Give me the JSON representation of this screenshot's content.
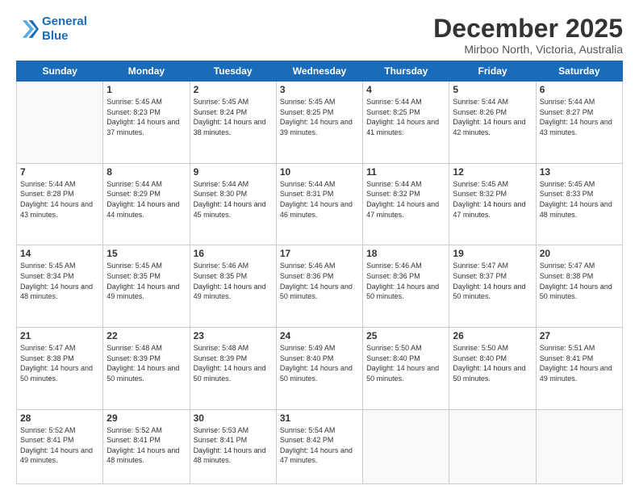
{
  "logo": {
    "line1": "General",
    "line2": "Blue"
  },
  "title": "December 2025",
  "subtitle": "Mirboo North, Victoria, Australia",
  "weekdays": [
    "Sunday",
    "Monday",
    "Tuesday",
    "Wednesday",
    "Thursday",
    "Friday",
    "Saturday"
  ],
  "weeks": [
    [
      {
        "day": "",
        "sunrise": "",
        "sunset": "",
        "daylight": ""
      },
      {
        "day": "1",
        "sunrise": "Sunrise: 5:45 AM",
        "sunset": "Sunset: 8:23 PM",
        "daylight": "Daylight: 14 hours and 37 minutes."
      },
      {
        "day": "2",
        "sunrise": "Sunrise: 5:45 AM",
        "sunset": "Sunset: 8:24 PM",
        "daylight": "Daylight: 14 hours and 38 minutes."
      },
      {
        "day": "3",
        "sunrise": "Sunrise: 5:45 AM",
        "sunset": "Sunset: 8:25 PM",
        "daylight": "Daylight: 14 hours and 39 minutes."
      },
      {
        "day": "4",
        "sunrise": "Sunrise: 5:44 AM",
        "sunset": "Sunset: 8:25 PM",
        "daylight": "Daylight: 14 hours and 41 minutes."
      },
      {
        "day": "5",
        "sunrise": "Sunrise: 5:44 AM",
        "sunset": "Sunset: 8:26 PM",
        "daylight": "Daylight: 14 hours and 42 minutes."
      },
      {
        "day": "6",
        "sunrise": "Sunrise: 5:44 AM",
        "sunset": "Sunset: 8:27 PM",
        "daylight": "Daylight: 14 hours and 43 minutes."
      }
    ],
    [
      {
        "day": "7",
        "sunrise": "Sunrise: 5:44 AM",
        "sunset": "Sunset: 8:28 PM",
        "daylight": "Daylight: 14 hours and 43 minutes."
      },
      {
        "day": "8",
        "sunrise": "Sunrise: 5:44 AM",
        "sunset": "Sunset: 8:29 PM",
        "daylight": "Daylight: 14 hours and 44 minutes."
      },
      {
        "day": "9",
        "sunrise": "Sunrise: 5:44 AM",
        "sunset": "Sunset: 8:30 PM",
        "daylight": "Daylight: 14 hours and 45 minutes."
      },
      {
        "day": "10",
        "sunrise": "Sunrise: 5:44 AM",
        "sunset": "Sunset: 8:31 PM",
        "daylight": "Daylight: 14 hours and 46 minutes."
      },
      {
        "day": "11",
        "sunrise": "Sunrise: 5:44 AM",
        "sunset": "Sunset: 8:32 PM",
        "daylight": "Daylight: 14 hours and 47 minutes."
      },
      {
        "day": "12",
        "sunrise": "Sunrise: 5:45 AM",
        "sunset": "Sunset: 8:32 PM",
        "daylight": "Daylight: 14 hours and 47 minutes."
      },
      {
        "day": "13",
        "sunrise": "Sunrise: 5:45 AM",
        "sunset": "Sunset: 8:33 PM",
        "daylight": "Daylight: 14 hours and 48 minutes."
      }
    ],
    [
      {
        "day": "14",
        "sunrise": "Sunrise: 5:45 AM",
        "sunset": "Sunset: 8:34 PM",
        "daylight": "Daylight: 14 hours and 48 minutes."
      },
      {
        "day": "15",
        "sunrise": "Sunrise: 5:45 AM",
        "sunset": "Sunset: 8:35 PM",
        "daylight": "Daylight: 14 hours and 49 minutes."
      },
      {
        "day": "16",
        "sunrise": "Sunrise: 5:46 AM",
        "sunset": "Sunset: 8:35 PM",
        "daylight": "Daylight: 14 hours and 49 minutes."
      },
      {
        "day": "17",
        "sunrise": "Sunrise: 5:46 AM",
        "sunset": "Sunset: 8:36 PM",
        "daylight": "Daylight: 14 hours and 50 minutes."
      },
      {
        "day": "18",
        "sunrise": "Sunrise: 5:46 AM",
        "sunset": "Sunset: 8:36 PM",
        "daylight": "Daylight: 14 hours and 50 minutes."
      },
      {
        "day": "19",
        "sunrise": "Sunrise: 5:47 AM",
        "sunset": "Sunset: 8:37 PM",
        "daylight": "Daylight: 14 hours and 50 minutes."
      },
      {
        "day": "20",
        "sunrise": "Sunrise: 5:47 AM",
        "sunset": "Sunset: 8:38 PM",
        "daylight": "Daylight: 14 hours and 50 minutes."
      }
    ],
    [
      {
        "day": "21",
        "sunrise": "Sunrise: 5:47 AM",
        "sunset": "Sunset: 8:38 PM",
        "daylight": "Daylight: 14 hours and 50 minutes."
      },
      {
        "day": "22",
        "sunrise": "Sunrise: 5:48 AM",
        "sunset": "Sunset: 8:39 PM",
        "daylight": "Daylight: 14 hours and 50 minutes."
      },
      {
        "day": "23",
        "sunrise": "Sunrise: 5:48 AM",
        "sunset": "Sunset: 8:39 PM",
        "daylight": "Daylight: 14 hours and 50 minutes."
      },
      {
        "day": "24",
        "sunrise": "Sunrise: 5:49 AM",
        "sunset": "Sunset: 8:40 PM",
        "daylight": "Daylight: 14 hours and 50 minutes."
      },
      {
        "day": "25",
        "sunrise": "Sunrise: 5:50 AM",
        "sunset": "Sunset: 8:40 PM",
        "daylight": "Daylight: 14 hours and 50 minutes."
      },
      {
        "day": "26",
        "sunrise": "Sunrise: 5:50 AM",
        "sunset": "Sunset: 8:40 PM",
        "daylight": "Daylight: 14 hours and 50 minutes."
      },
      {
        "day": "27",
        "sunrise": "Sunrise: 5:51 AM",
        "sunset": "Sunset: 8:41 PM",
        "daylight": "Daylight: 14 hours and 49 minutes."
      }
    ],
    [
      {
        "day": "28",
        "sunrise": "Sunrise: 5:52 AM",
        "sunset": "Sunset: 8:41 PM",
        "daylight": "Daylight: 14 hours and 49 minutes."
      },
      {
        "day": "29",
        "sunrise": "Sunrise: 5:52 AM",
        "sunset": "Sunset: 8:41 PM",
        "daylight": "Daylight: 14 hours and 48 minutes."
      },
      {
        "day": "30",
        "sunrise": "Sunrise: 5:53 AM",
        "sunset": "Sunset: 8:41 PM",
        "daylight": "Daylight: 14 hours and 48 minutes."
      },
      {
        "day": "31",
        "sunrise": "Sunrise: 5:54 AM",
        "sunset": "Sunset: 8:42 PM",
        "daylight": "Daylight: 14 hours and 47 minutes."
      },
      {
        "day": "",
        "sunrise": "",
        "sunset": "",
        "daylight": ""
      },
      {
        "day": "",
        "sunrise": "",
        "sunset": "",
        "daylight": ""
      },
      {
        "day": "",
        "sunrise": "",
        "sunset": "",
        "daylight": ""
      }
    ]
  ]
}
